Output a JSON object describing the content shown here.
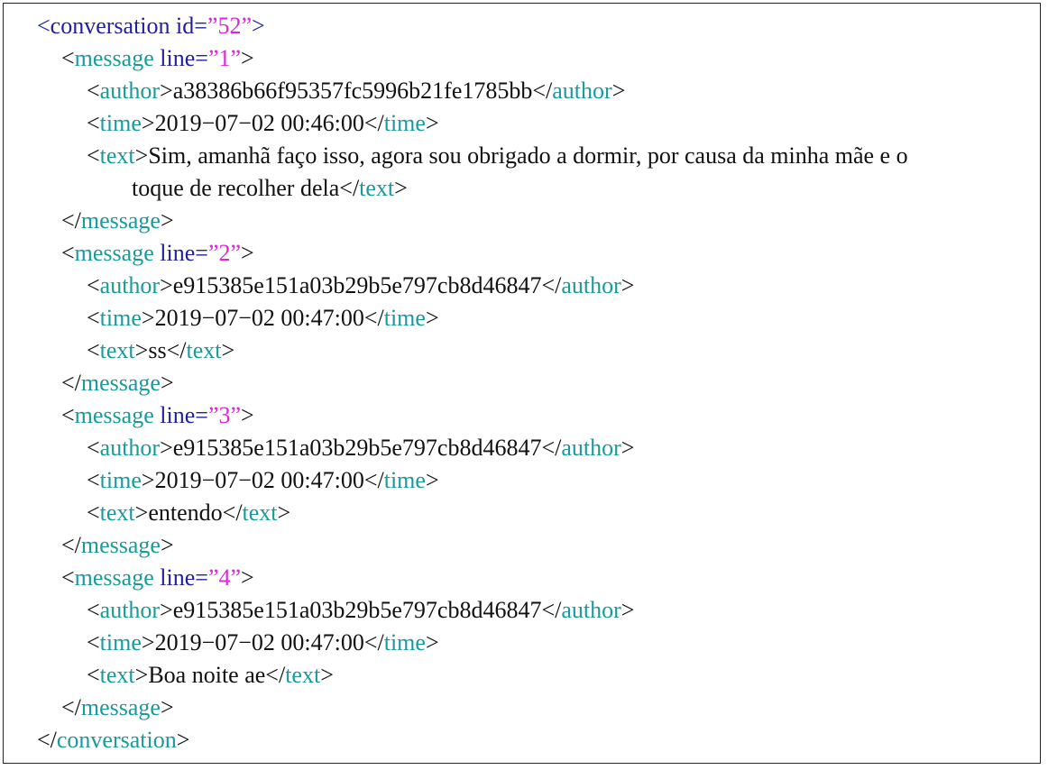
{
  "conversation": {
    "tag": "conversation",
    "id_attr": "id",
    "id_value": "”52”"
  },
  "messages": [
    {
      "line_attr": "line",
      "line_value": "”1”",
      "author": "a38386b66f95357fc5996b21fe1785bb",
      "time": "2019−07−02 00:46:00",
      "text_part1": "Sim, amanhã faço isso, agora sou obrigado a dormir, por causa da minha mãe e o",
      "text_part2": "toque de recolher dela"
    },
    {
      "line_attr": "line",
      "line_value": "”2”",
      "author": "e915385e151a03b29b5e797cb8d46847",
      "time": "2019−07−02 00:47:00",
      "text": "ss"
    },
    {
      "line_attr": "line",
      "line_value": "”3”",
      "author": "e915385e151a03b29b5e797cb8d46847",
      "time": "2019−07−02 00:47:00",
      "text": "entendo"
    },
    {
      "line_attr": "line",
      "line_value": "”4”",
      "author": "e915385e151a03b29b5e797cb8d46847",
      "time": "2019−07−02 00:47:00",
      "text": "Boa noite ae"
    }
  ],
  "tags": {
    "message": "message",
    "author": "author",
    "time": "time",
    "text": "text"
  },
  "colors": {
    "tag_blue": "#1f1fa0",
    "tag_teal": "#1a9a9a",
    "attr_value": "#e026d6"
  }
}
